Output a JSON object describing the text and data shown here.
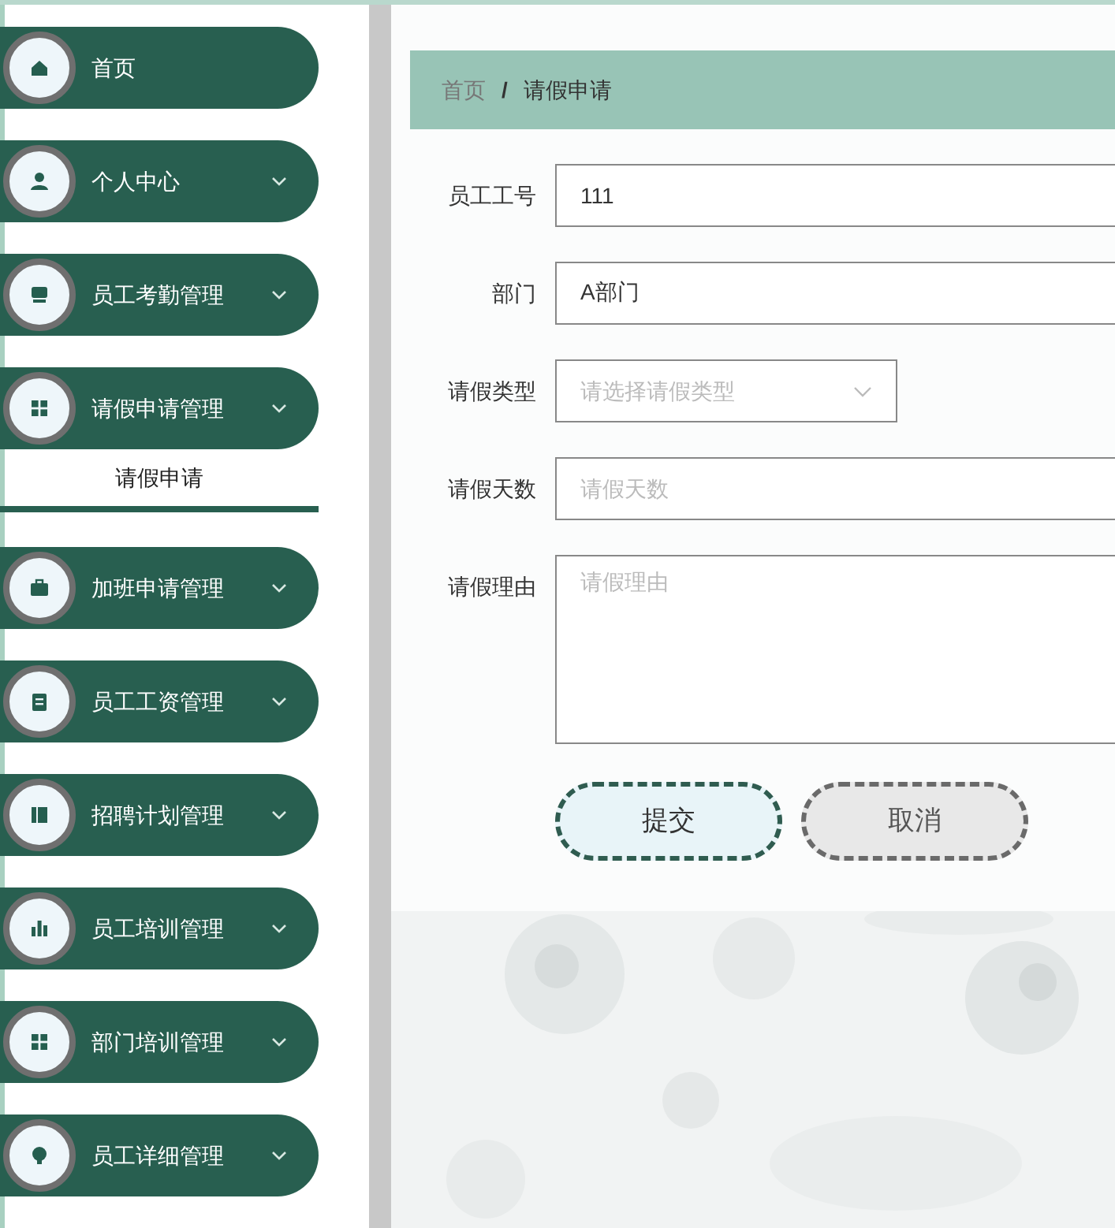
{
  "sidebar": {
    "items": [
      {
        "label": "首页",
        "kind": "link"
      },
      {
        "label": "个人中心",
        "kind": "menu"
      },
      {
        "label": "员工考勤管理",
        "kind": "menu"
      },
      {
        "label": "请假申请管理",
        "kind": "menu",
        "children": [
          {
            "label": "请假申请"
          }
        ]
      },
      {
        "label": "加班申请管理",
        "kind": "menu"
      },
      {
        "label": "员工工资管理",
        "kind": "menu"
      },
      {
        "label": "招聘计划管理",
        "kind": "menu"
      },
      {
        "label": "员工培训管理",
        "kind": "menu"
      },
      {
        "label": "部门培训管理",
        "kind": "menu"
      },
      {
        "label": "员工详细管理",
        "kind": "menu"
      }
    ]
  },
  "breadcrumb": [
    "首页",
    "请假申请"
  ],
  "breadcrumb_separator": "/",
  "form": {
    "fields": [
      {
        "kind": "text",
        "label": "员工工号",
        "value": "111"
      },
      {
        "kind": "text",
        "label": "部门",
        "value": "A部门"
      },
      {
        "kind": "select",
        "label": "请假类型",
        "placeholder": "请选择请假类型"
      },
      {
        "kind": "text",
        "label": "请假天数",
        "placeholder": "请假天数"
      },
      {
        "kind": "textarea",
        "label": "请假理由",
        "placeholder": "请假理由"
      }
    ]
  },
  "buttons": [
    {
      "kind": "submit",
      "label": "提交"
    },
    {
      "kind": "cancel",
      "label": "取消"
    }
  ]
}
